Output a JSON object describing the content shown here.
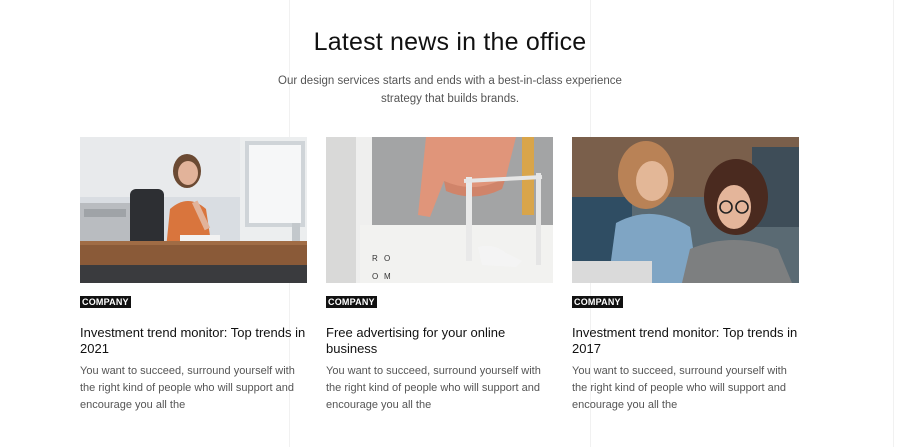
{
  "section": {
    "title": "Latest news in the office",
    "subtitle_line1": "Our design services starts and ends with a best-in-class experience",
    "subtitle_line2": "strategy that builds brands."
  },
  "articles": [
    {
      "category": "COMPANY",
      "title": "Investment trend monitor: Top trends in 2021",
      "excerpt": "You want to succeed, surround yourself with the right kind of people who will support and encourage you all the",
      "image": "woman-at-desk-on-phone-photo"
    },
    {
      "category": "COMPANY",
      "title": "Free advertising for your online business",
      "excerpt": "You want to succeed, surround yourself with the right kind of people who will support and encourage you all the",
      "image": "office-stool-and-whiteboard-photo",
      "image_text": [
        "R",
        "O",
        "O",
        "M"
      ]
    },
    {
      "category": "COMPANY",
      "title": "Investment trend monitor: Top trends in 2017",
      "excerpt": "You want to succeed, surround yourself with the right kind of people who will support and encourage you all the",
      "image": "two-women-at-laptop-photo"
    }
  ]
}
